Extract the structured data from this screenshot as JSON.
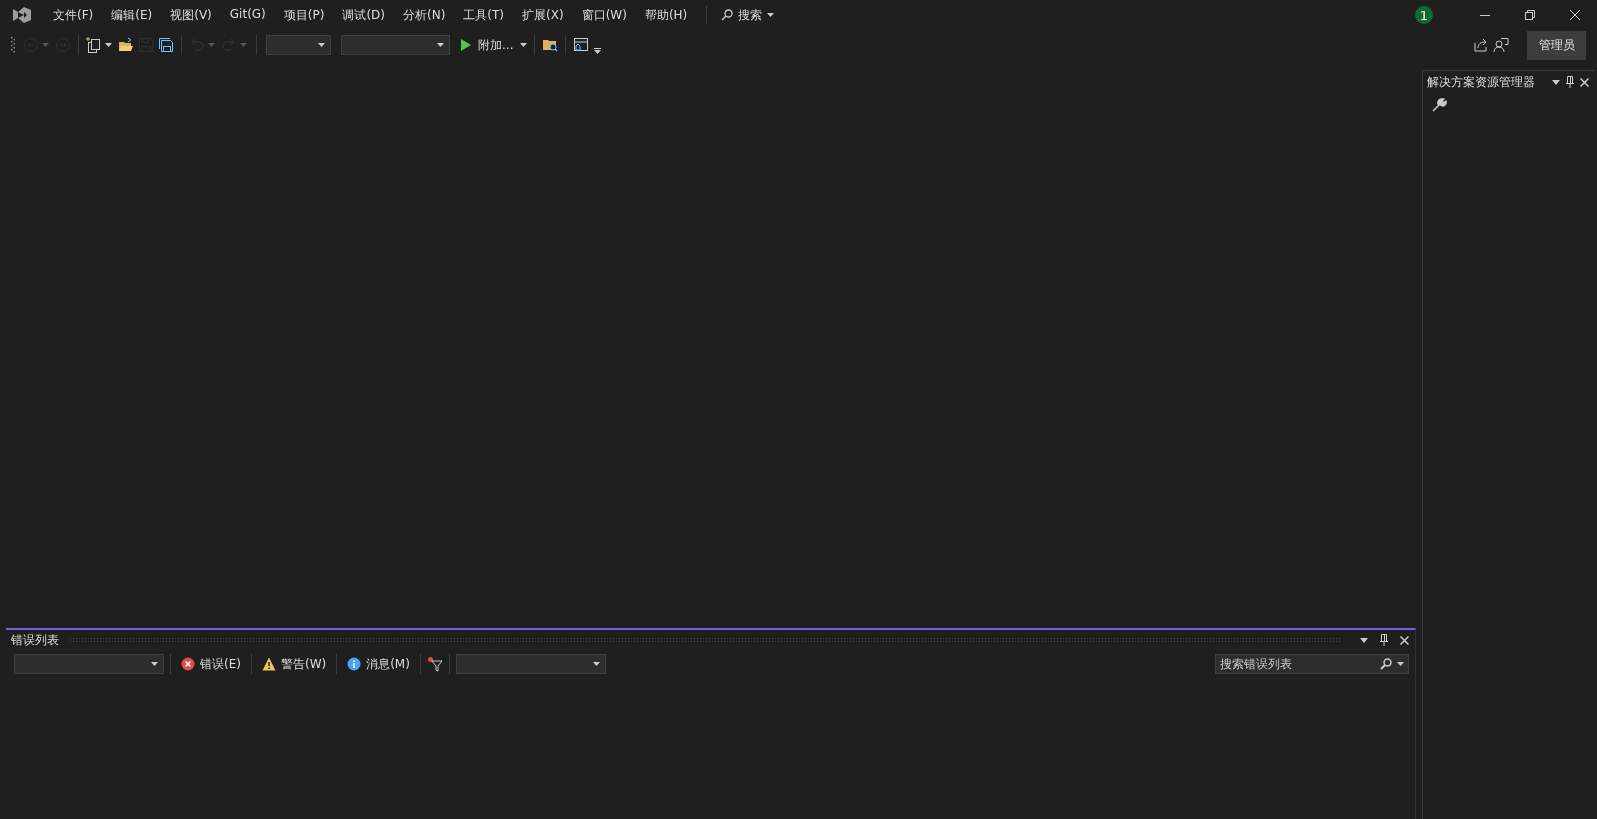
{
  "title_bar": {
    "menu": [
      {
        "label": "文件(F)"
      },
      {
        "label": "编辑(E)"
      },
      {
        "label": "视图(V)"
      },
      {
        "label": "Git(G)"
      },
      {
        "label": "项目(P)"
      },
      {
        "label": "调试(D)"
      },
      {
        "label": "分析(N)"
      },
      {
        "label": "工具(T)"
      },
      {
        "label": "扩展(X)"
      },
      {
        "label": "窗口(W)"
      },
      {
        "label": "帮助(H)"
      }
    ],
    "search": "搜索",
    "notification_count": "1"
  },
  "toolbar": {
    "items": [
      {
        "kind": "back",
        "disabled": true
      },
      {
        "kind": "forward",
        "disabled": true
      },
      {
        "kind": "separator"
      },
      {
        "kind": "newitem",
        "disabled": false
      },
      {
        "kind": "open",
        "disabled": false
      },
      {
        "kind": "save",
        "disabled": true
      },
      {
        "kind": "saveall",
        "disabled": false
      },
      {
        "kind": "separator"
      },
      {
        "kind": "undo",
        "disabled": true
      },
      {
        "kind": "redo",
        "disabled": true
      },
      {
        "kind": "separator"
      },
      {
        "kind": "combo"
      },
      {
        "kind": "widecombo"
      },
      {
        "kind": "run",
        "label": "附加...",
        "disabled": false
      },
      {
        "kind": "separator"
      },
      {
        "kind": "findfolder",
        "disabled": false
      },
      {
        "kind": "separator"
      },
      {
        "kind": "layout",
        "disabled": false
      }
    ],
    "account_button": "管理员"
  },
  "solution_explorer": {
    "title": "解决方案资源管理器"
  },
  "error_list": {
    "title": "错误列表",
    "filters": [
      {
        "kind": "error",
        "label": "错误(E)"
      },
      {
        "kind": "warning",
        "label": "警告(W)"
      },
      {
        "kind": "message",
        "label": "消息(M)"
      }
    ],
    "search": {
      "placeholder": "搜索错误列表"
    }
  }
}
